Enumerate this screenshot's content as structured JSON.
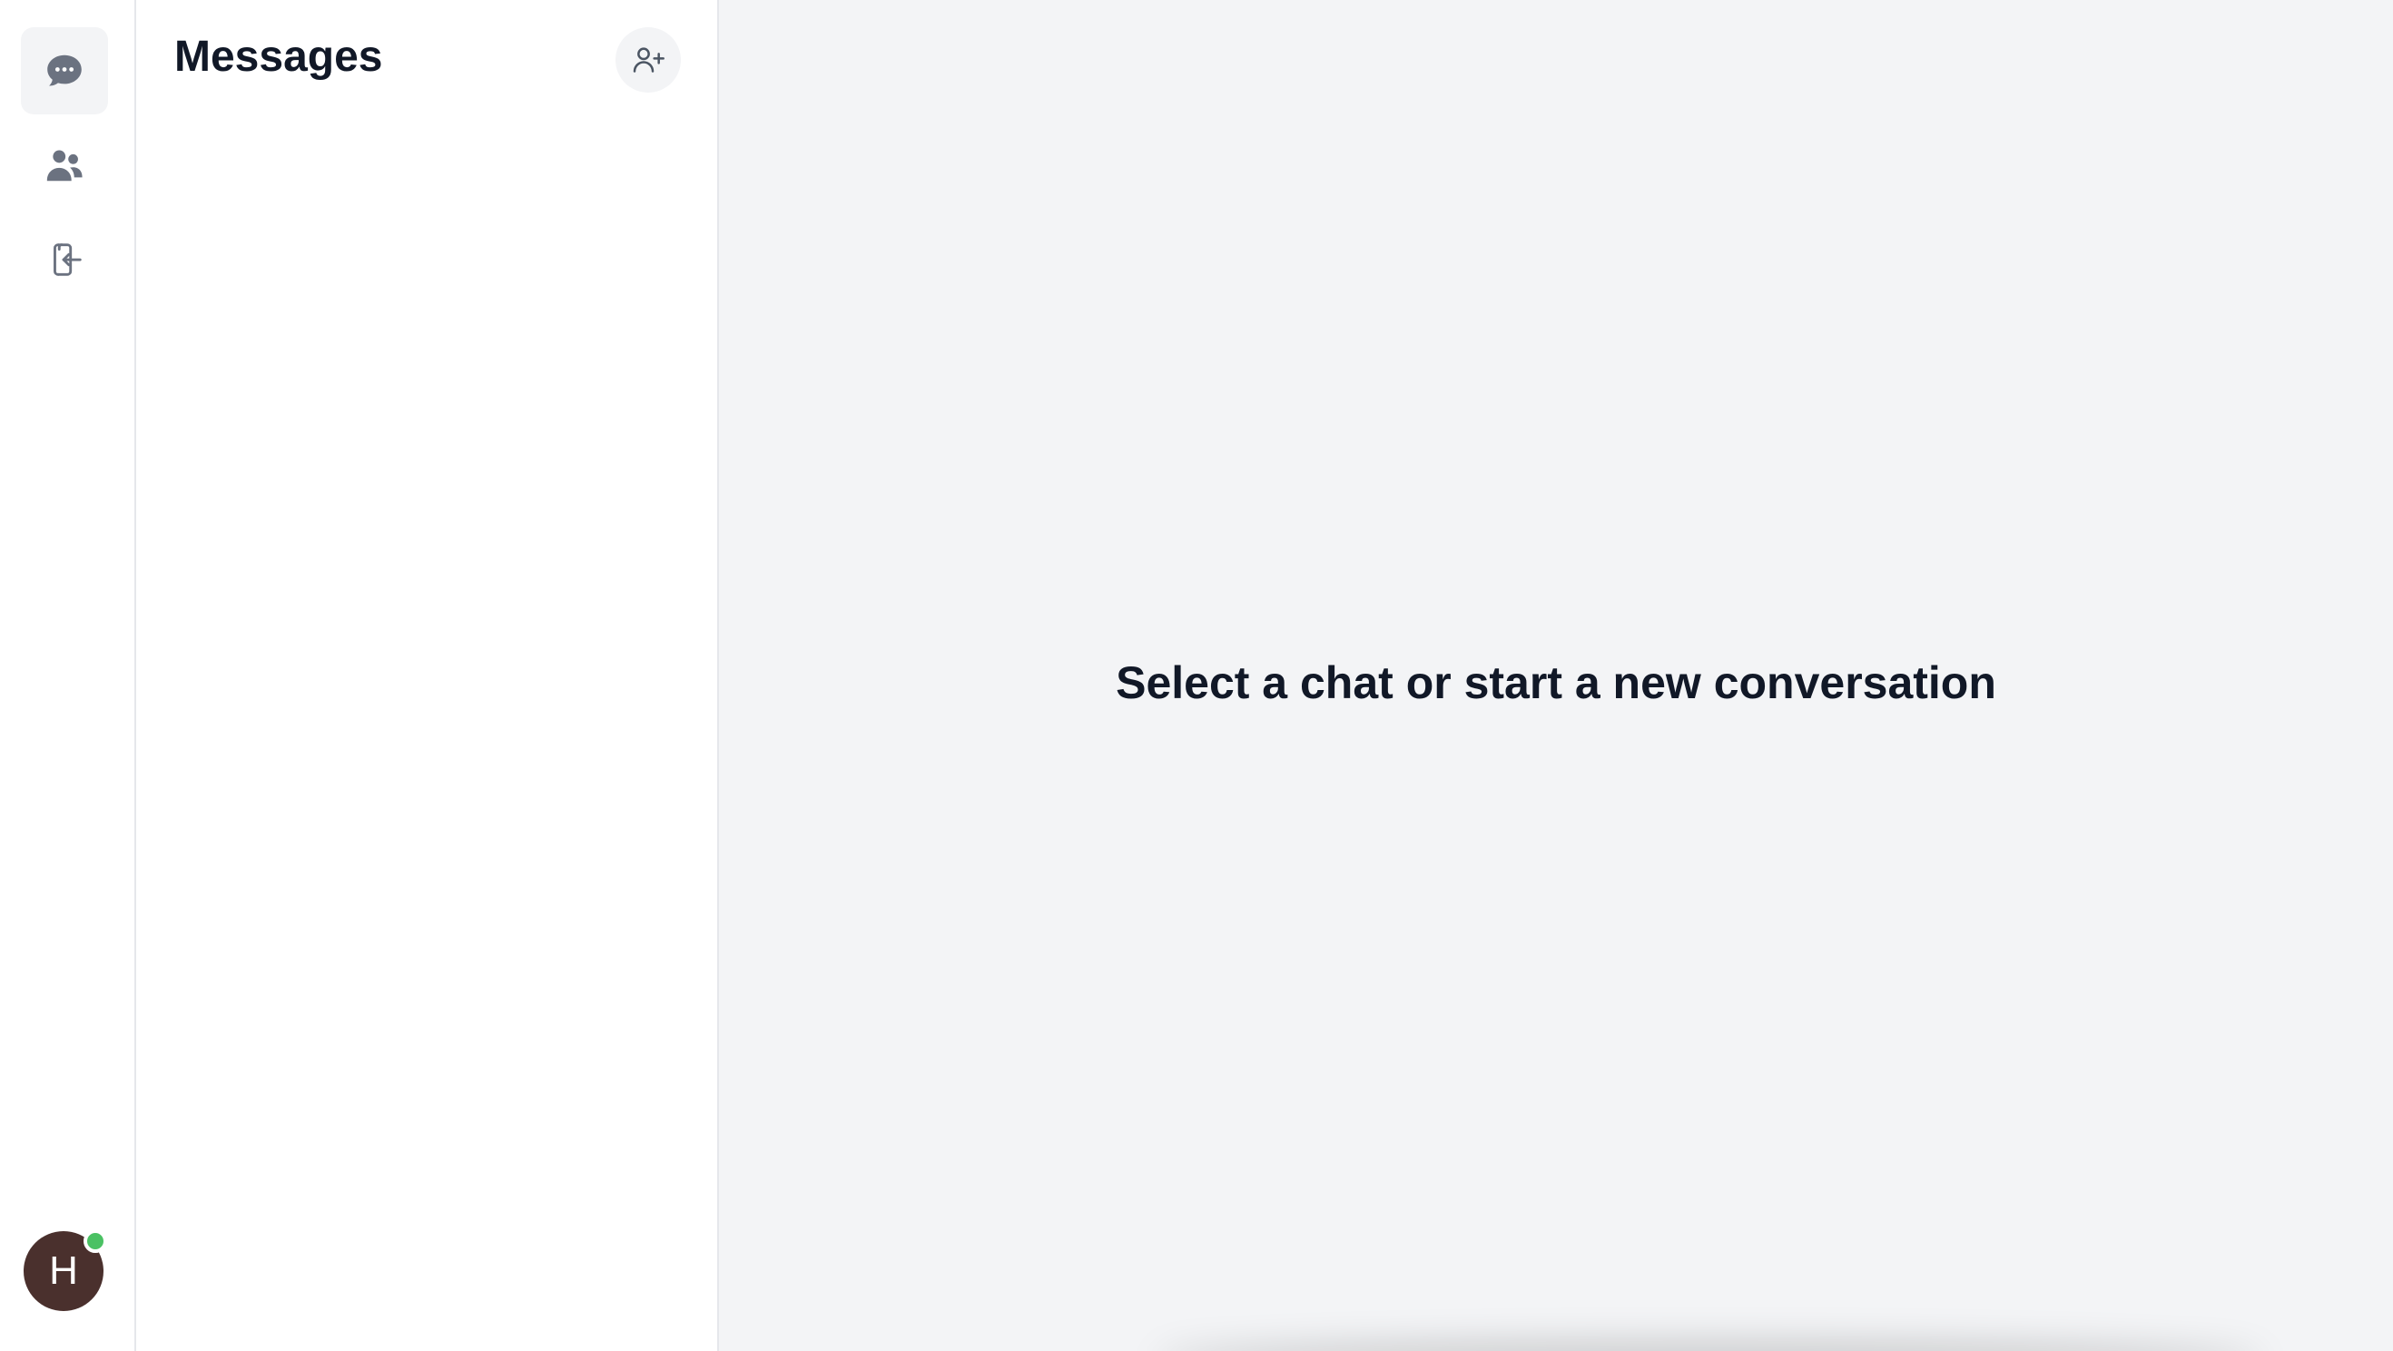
{
  "rail": {
    "items": [
      {
        "name": "chats",
        "icon": "chat-bubble-icon",
        "active": true
      },
      {
        "name": "contacts",
        "icon": "users-icon",
        "active": false
      },
      {
        "name": "logout",
        "icon": "logout-icon",
        "active": false
      }
    ],
    "user": {
      "initial": "H",
      "status": "online",
      "avatar_color": "#4a302d",
      "status_color": "#4ac163"
    }
  },
  "panel": {
    "title": "Messages",
    "new_chat_icon": "user-plus-icon",
    "conversations": []
  },
  "main": {
    "empty_message": "Select a chat or start a new conversation"
  },
  "colors": {
    "icon": "#6b7280",
    "text": "#111827",
    "main_bg": "#f3f4f6",
    "panel_bg": "#ffffff"
  }
}
